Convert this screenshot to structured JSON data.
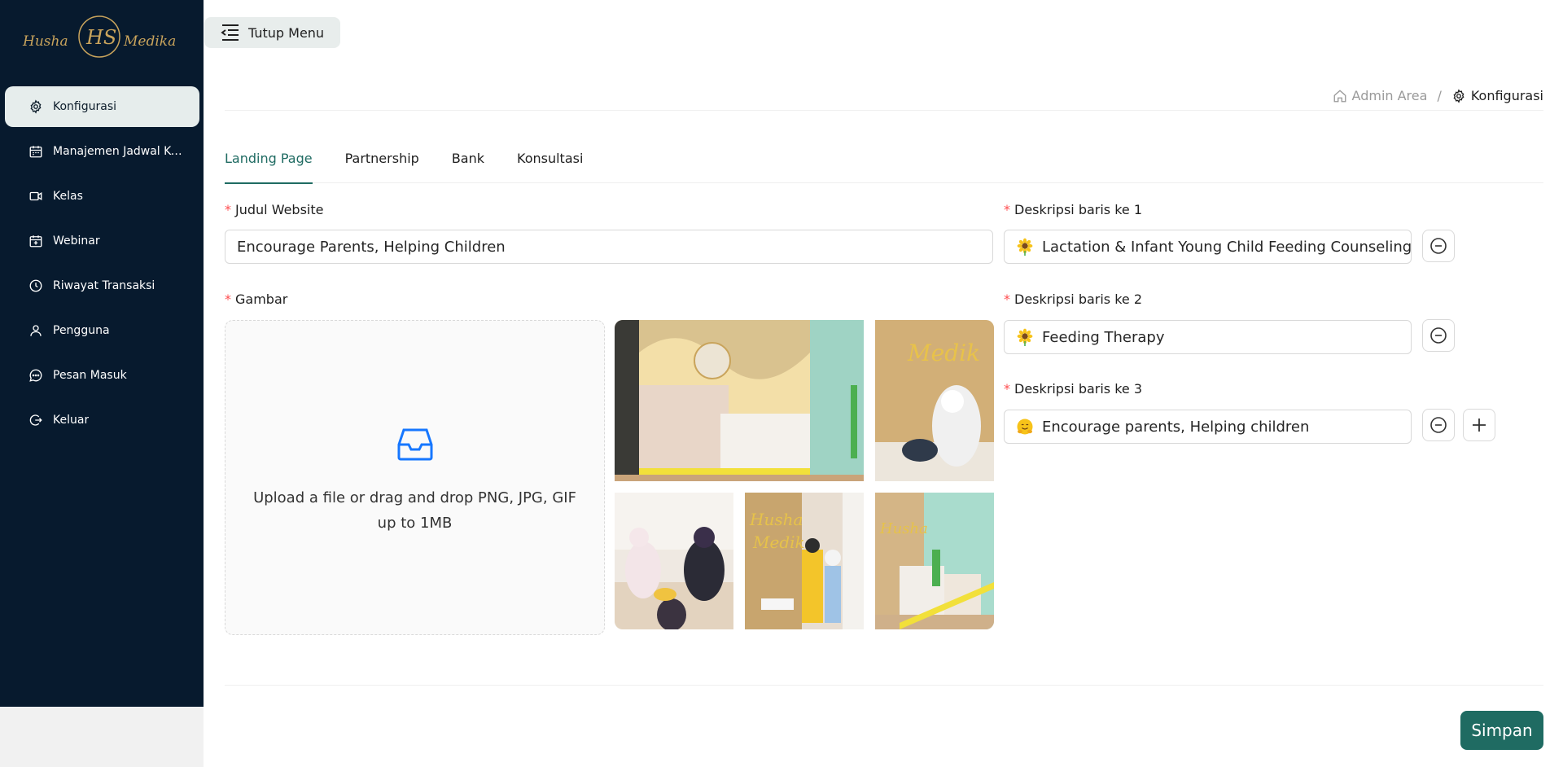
{
  "brand": {
    "logo_text_left": "Husha",
    "logo_text_right": "Medika",
    "logo_monogram": "HS",
    "gold": "#c9a45c"
  },
  "sidebar": {
    "items": [
      {
        "label": "Konfigurasi",
        "icon": "gear-icon",
        "active": true
      },
      {
        "label": "Manajemen Jadwal Ko...",
        "icon": "calendar-icon",
        "active": false
      },
      {
        "label": "Kelas",
        "icon": "video-icon",
        "active": false
      },
      {
        "label": "Webinar",
        "icon": "screen-calendar-icon",
        "active": false
      },
      {
        "label": "Riwayat Transaksi",
        "icon": "history-icon",
        "active": false
      },
      {
        "label": "Pengguna",
        "icon": "user-icon",
        "active": false
      },
      {
        "label": "Pesan Masuk",
        "icon": "message-icon",
        "active": false
      },
      {
        "label": "Keluar",
        "icon": "logout-icon",
        "active": false
      }
    ]
  },
  "header": {
    "menu_toggle_label": "Tutup Menu"
  },
  "breadcrumb": {
    "root": "Admin Area",
    "separator": "/",
    "current": "Konfigurasi"
  },
  "tabs": [
    {
      "label": "Landing Page",
      "active": true
    },
    {
      "label": "Partnership",
      "active": false
    },
    {
      "label": "Bank",
      "active": false
    },
    {
      "label": "Konsultasi",
      "active": false
    }
  ],
  "form": {
    "title_label": "Judul Website",
    "title_value": "Encourage Parents, Helping Children",
    "image_label": "Gambar",
    "upload_text": "Upload a file or drag and drop PNG, JPG, GIF up to 1MB",
    "descriptions": [
      {
        "label": "Deskripsi baris ke 1",
        "emoji": "sunflower",
        "value": "Lactation & Infant Young Child Feeding Counseling"
      },
      {
        "label": "Deskripsi baris ke 2",
        "emoji": "sunflower",
        "value": "Feeding Therapy"
      },
      {
        "label": "Deskripsi baris ke 3",
        "emoji": "hugging-face",
        "value": "Encourage parents, Helping children"
      }
    ],
    "save_label": "Simpan"
  },
  "colors": {
    "sidebar_bg": "#071a2e",
    "accent": "#1f6b62",
    "required": "#ff4d4f",
    "upload_icon": "#1677ff"
  }
}
